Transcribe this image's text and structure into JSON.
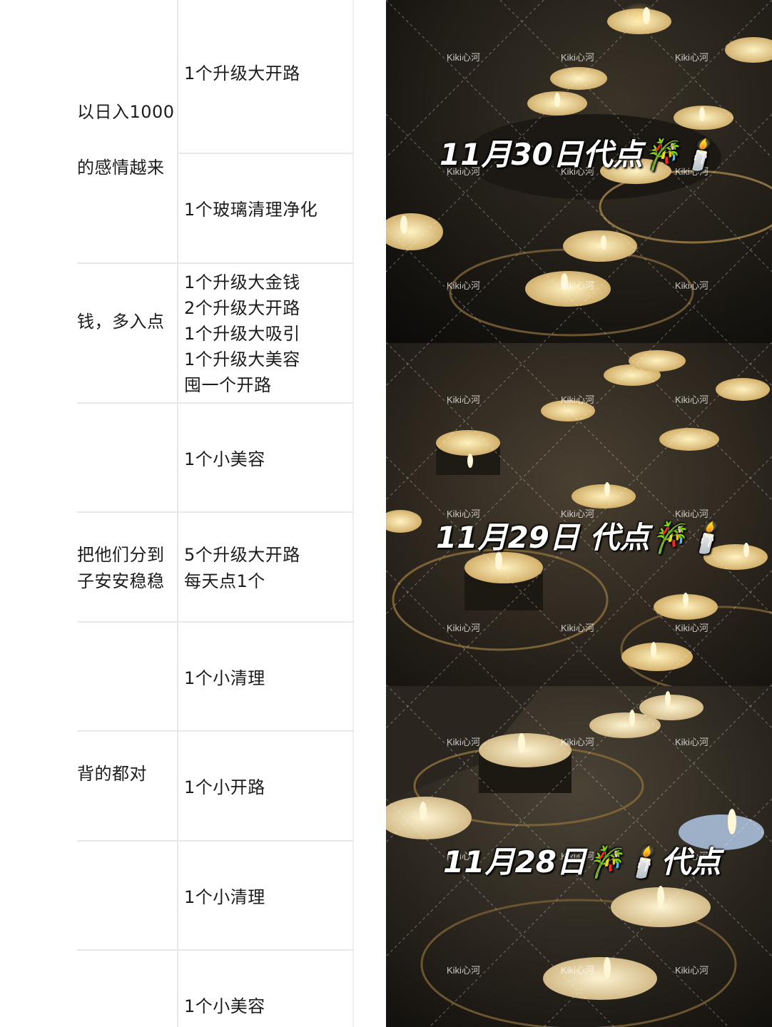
{
  "table": {
    "rows": [
      {
        "a": [
          "以日入1000"
        ],
        "b": [
          "1个升级大开路"
        ]
      },
      {
        "a": [
          "的感情越来"
        ],
        "b": [
          "1个玻璃清理净化"
        ]
      },
      {
        "a": [
          "钱，多入点"
        ],
        "b": [
          "1个升级大金钱",
          "2个升级大开路",
          "1个升级大吸引",
          "1个升级大美容",
          "囤一个开路"
        ]
      },
      {
        "a": [],
        "b": [
          "1个小美容"
        ]
      },
      {
        "a": [
          "把他们分到",
          "子安安稳稳"
        ],
        "b": [
          "5个升级大开路",
          "每天点1个"
        ]
      },
      {
        "a": [],
        "b": [
          "1个小清理"
        ]
      },
      {
        "a": [
          "背的都对"
        ],
        "b": [
          "1个小开路"
        ]
      },
      {
        "a": [],
        "b": [
          "1个小清理"
        ]
      },
      {
        "a": [],
        "b": [
          "1个小美容"
        ]
      }
    ]
  },
  "photos": {
    "watermark": "Kiki心河",
    "captions": [
      "11月30日代点🎋🕯️",
      "11月29日 代点🎋🕯️",
      "11月28日🎋🕯️代点"
    ]
  },
  "colors": {
    "flame": "#ffe9a8",
    "candle_wax": "#efd69a",
    "tin": "#2b2620"
  }
}
